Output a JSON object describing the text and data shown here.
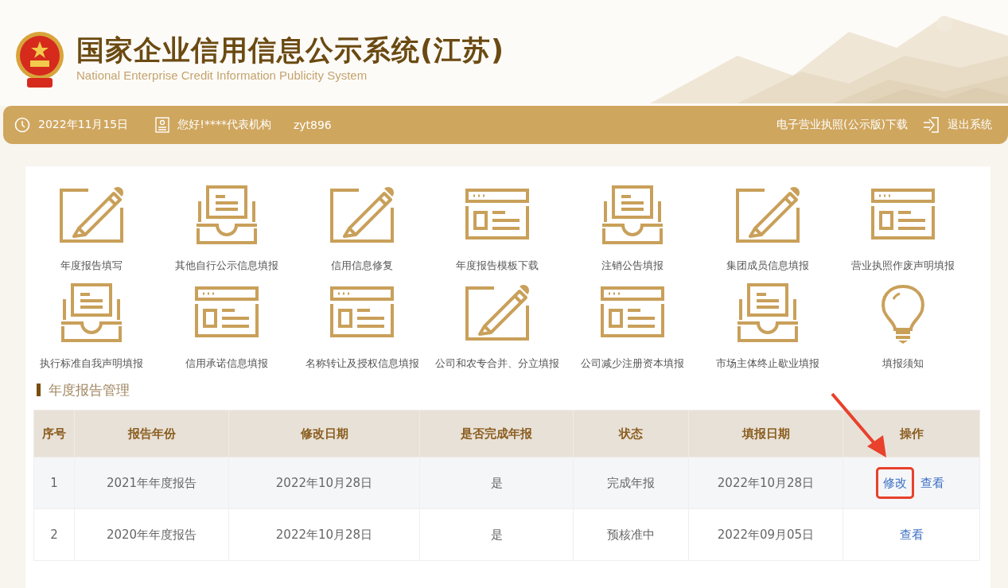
{
  "header": {
    "title": "国家企业信用信息公示系统(江苏)",
    "subtitle": "National Enterprise Credit Information Publicity System"
  },
  "top_bar": {
    "date": "2022年11月15日",
    "greeting": "您好!****代表机构",
    "username": "zyt896",
    "license_link": "电子营业执照(公示版)下载",
    "logout": "退出系统"
  },
  "tiles": [
    {
      "label": "年度报告填写",
      "kind": "pencil"
    },
    {
      "label": "其他自行公示信息填报",
      "kind": "tray"
    },
    {
      "label": "信用信息修复",
      "kind": "pencil"
    },
    {
      "label": "年度报告模板下载",
      "kind": "window"
    },
    {
      "label": "注销公告填报",
      "kind": "tray"
    },
    {
      "label": "集团成员信息填报",
      "kind": "pencil"
    },
    {
      "label": "营业执照作废声明填报",
      "kind": "window"
    },
    {
      "label": "执行标准自我声明填报",
      "kind": "tray"
    },
    {
      "label": "信用承诺信息填报",
      "kind": "window"
    },
    {
      "label": "名称转让及授权信息填报",
      "kind": "window"
    },
    {
      "label": "公司和农专合并、分立填报",
      "kind": "pencil"
    },
    {
      "label": "公司减少注册资本填报",
      "kind": "window"
    },
    {
      "label": "市场主体终止歇业填报",
      "kind": "tray"
    },
    {
      "label": "填报须知",
      "kind": "bulb"
    }
  ],
  "section_title": "年度报告管理",
  "table": {
    "columns": [
      "序号",
      "报告年份",
      "修改日期",
      "是否完成年报",
      "状态",
      "填报日期",
      "操作"
    ],
    "rows": [
      {
        "cells": [
          "1",
          "2021年年度报告",
          "2022年10月28日",
          "是",
          "完成年报",
          "2022年10月28日"
        ],
        "actions": [
          {
            "label": "修改",
            "highlighted": true
          },
          {
            "label": "查看",
            "highlighted": false
          }
        ]
      },
      {
        "cells": [
          "2",
          "2020年年度报告",
          "2022年10月28日",
          "是",
          "预核准中",
          "2022年09月05日"
        ],
        "actions": [
          {
            "label": "查看",
            "highlighted": false
          }
        ]
      }
    ]
  }
}
